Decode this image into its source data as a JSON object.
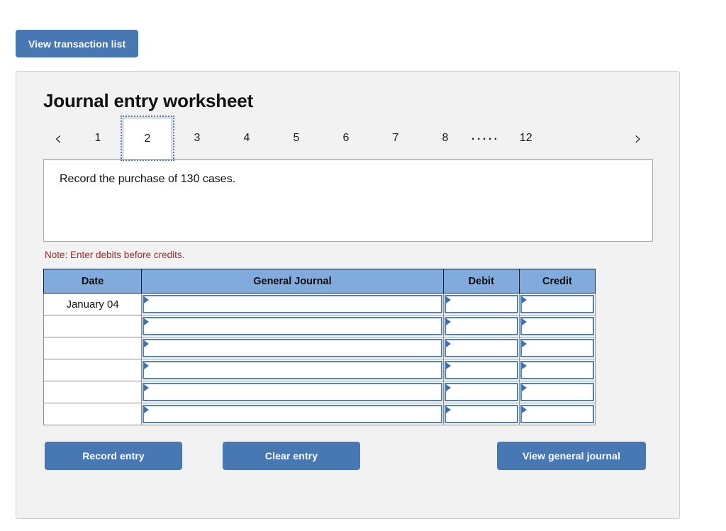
{
  "toolbar": {
    "view_transaction_list_label": "View transaction list"
  },
  "panel": {
    "title": "Journal entry worksheet",
    "pager": {
      "prev_icon": "‹",
      "next_icon": "›",
      "pages": [
        "1",
        "2",
        "3",
        "4",
        "5",
        "6",
        "7",
        "8"
      ],
      "ellipsis": ".....",
      "last_page": "12",
      "active_page": "2"
    },
    "description": "Record the purchase of 130 cases.",
    "note": "Note: Enter debits before credits.",
    "table": {
      "headers": [
        "Date",
        "General Journal",
        "Debit",
        "Credit"
      ],
      "rows": [
        {
          "date": "January 04",
          "general_journal": "",
          "debit": "",
          "credit": ""
        },
        {
          "date": "",
          "general_journal": "",
          "debit": "",
          "credit": ""
        },
        {
          "date": "",
          "general_journal": "",
          "debit": "",
          "credit": ""
        },
        {
          "date": "",
          "general_journal": "",
          "debit": "",
          "credit": ""
        },
        {
          "date": "",
          "general_journal": "",
          "debit": "",
          "credit": ""
        },
        {
          "date": "",
          "general_journal": "",
          "debit": "",
          "credit": ""
        }
      ]
    },
    "actions": {
      "record_entry_label": "Record entry",
      "clear_entry_label": "Clear entry",
      "view_general_journal_label": "View general journal"
    }
  },
  "colors": {
    "button_blue": "#4878b4",
    "header_blue": "#82abdd",
    "input_border_blue": "#5282bd",
    "note_red": "#9e2a28",
    "panel_bg": "#f2f2f2"
  }
}
